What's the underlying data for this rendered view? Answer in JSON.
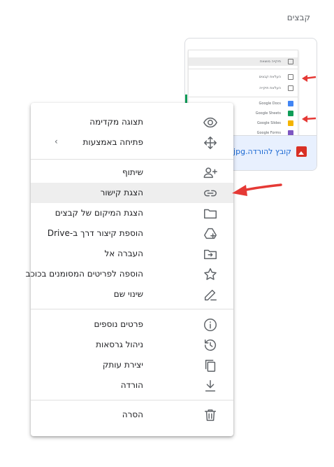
{
  "section_title": "קבצים",
  "file_card": {
    "name": "קובץ להורדה.jpg",
    "thumbnail_rows": [
      "תיקייה מושאת",
      "העלאת קבצים",
      "העלאת תיקייה",
      "Google Docs",
      "Google Sheets",
      "Google Slides",
      "Google Forms"
    ]
  },
  "menu": {
    "items": [
      {
        "label": "תצוגה מקדימה",
        "icon": "eye-icon"
      },
      {
        "label": "פתיחה באמצעות",
        "icon": "move-arrows-icon",
        "submenu": "›"
      },
      {
        "label": "שיתוף",
        "icon": "person-add-icon"
      },
      {
        "label": "הצגת קישור",
        "icon": "link-icon"
      },
      {
        "label": "הצגת המיקום של קבצים",
        "icon": "folder-icon"
      },
      {
        "label": "הוספת קיצור דרך ב-Drive",
        "icon": "drive-shortcut-icon"
      },
      {
        "label": "העברה אל",
        "icon": "folder-move-icon"
      },
      {
        "label": "הוספה לפריטים המסומנים בכוכב",
        "icon": "star-icon"
      },
      {
        "label": "שינוי שם",
        "icon": "pencil-icon"
      },
      {
        "label": "פרטים נוספים",
        "icon": "info-icon"
      },
      {
        "label": "ניהול גרסאות",
        "icon": "history-icon"
      },
      {
        "label": "יצירת עותק",
        "icon": "copy-icon"
      },
      {
        "label": "הורדה",
        "icon": "download-icon"
      },
      {
        "label": "הסרה",
        "icon": "trash-icon"
      }
    ]
  },
  "colors": {
    "highlight": "#eeeeee",
    "accent": "#1967d2",
    "arrow": "#e53935"
  }
}
